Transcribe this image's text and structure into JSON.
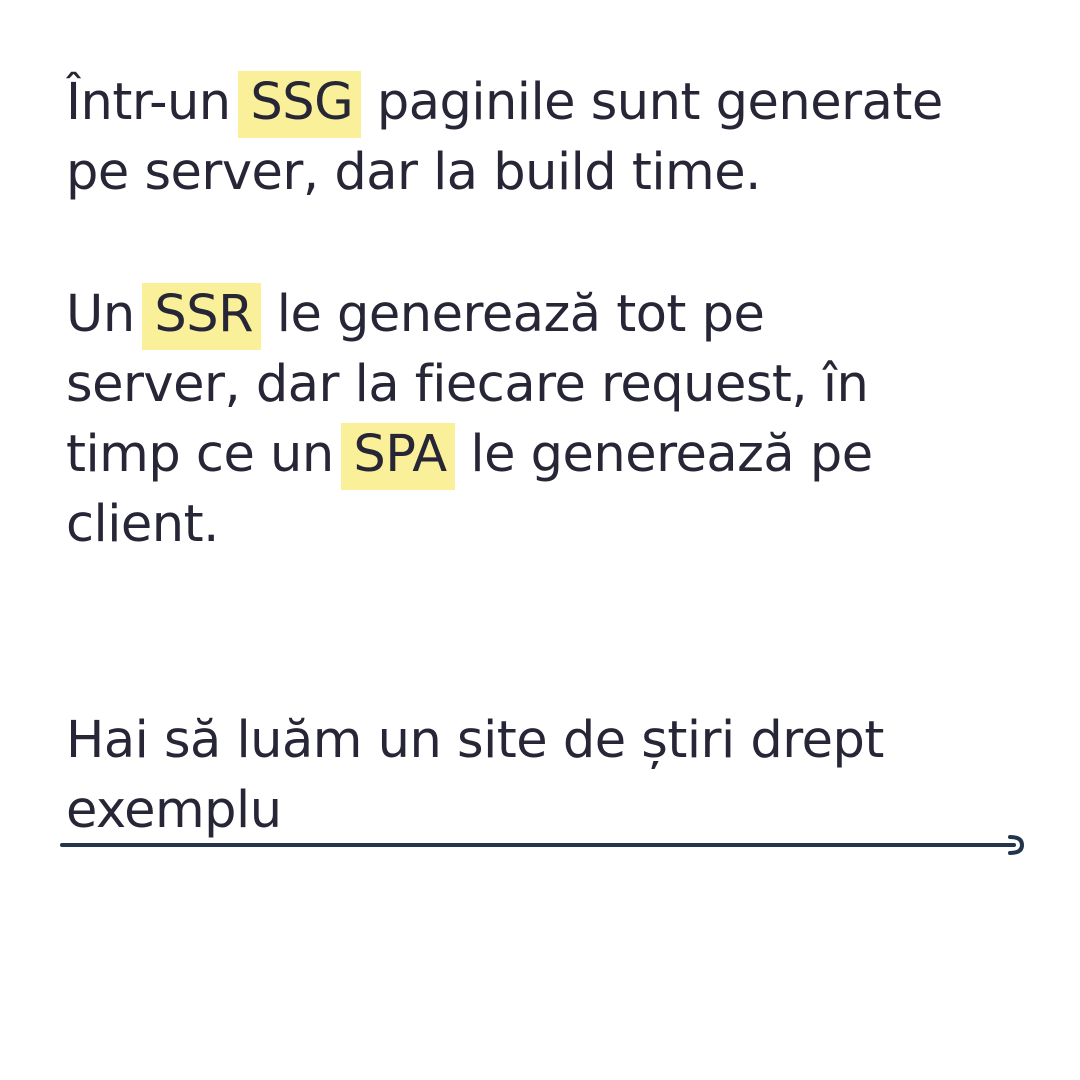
{
  "paragraphs": {
    "ssg": {
      "pre": "Într-un ",
      "highlight": "SSG",
      "line1_post": " paginile sunt generate",
      "line2": "pe server, dar la build time."
    },
    "ssr_spa": {
      "pre": "Un ",
      "highlight_ssr": "SSR",
      "line1_post": " le generează tot pe",
      "line2": "server, dar la fiecare request, în",
      "line3_pre": "timp ce un ",
      "highlight_spa": "SPA",
      "line3_post": " le generează pe",
      "line4": "client."
    },
    "example": {
      "line1": "Hai să luăm un site de știri drept",
      "line2": "exemplu"
    }
  },
  "colors": {
    "text": "#262636",
    "highlight": "#faf09a",
    "arrow": "#22354d"
  },
  "icons": {
    "next": "right-arrow-icon"
  }
}
